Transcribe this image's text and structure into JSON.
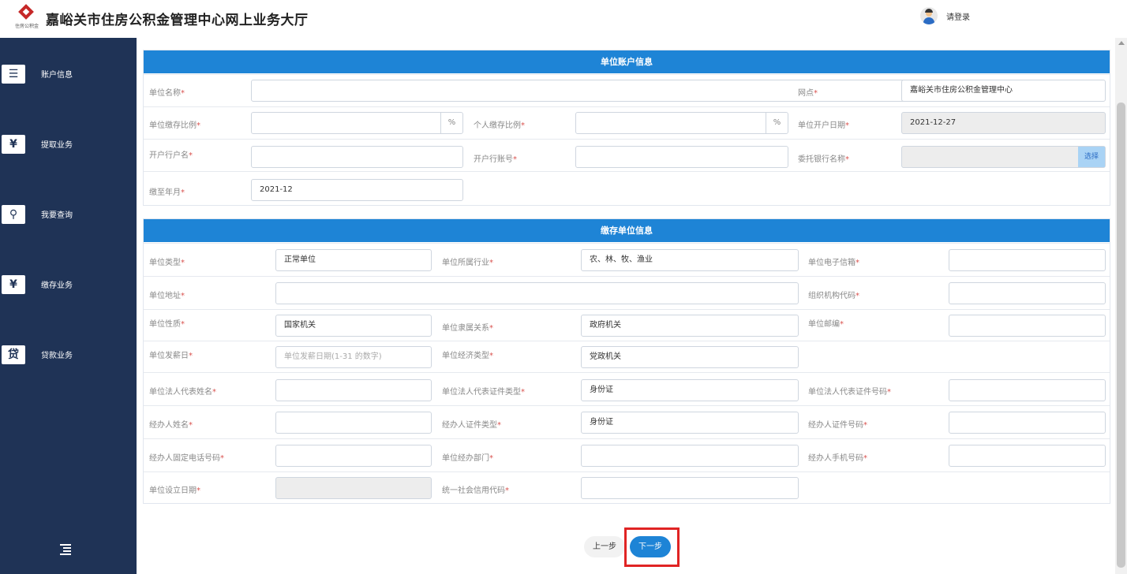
{
  "header": {
    "logo_text": "住房公积金",
    "title": "嘉峪关市住房公积金管理中心网上业务大厅",
    "login_label": "请登录"
  },
  "sidebar": {
    "items": [
      {
        "label": "账户信息",
        "icon": "account-card-icon",
        "glyph": "☰"
      },
      {
        "label": "提取业务",
        "icon": "yen-doc-icon",
        "glyph": "¥"
      },
      {
        "label": "我要查询",
        "icon": "search-icon",
        "glyph": "⚲"
      },
      {
        "label": "缴存业务",
        "icon": "yen-icon",
        "glyph": "¥"
      },
      {
        "label": "贷款业务",
        "icon": "loan-icon",
        "glyph": "贷"
      }
    ],
    "collapse_icon": "menu-collapse-icon"
  },
  "section1": {
    "title": "单位账户信息",
    "fields": {
      "unit_name": {
        "label": "单位名称",
        "value": ""
      },
      "branch": {
        "label": "网点",
        "value": "嘉峪关市住房公积金管理中心"
      },
      "unit_ratio": {
        "label": "单位缴存比例",
        "value": "",
        "unit": "%"
      },
      "personal_ratio": {
        "label": "个人缴存比例",
        "value": "",
        "unit": "%"
      },
      "open_date": {
        "label": "单位开户日期",
        "value": "2021-12-27"
      },
      "bank_account_name": {
        "label": "开户行户名",
        "value": ""
      },
      "bank_account_no": {
        "label": "开户行账号",
        "value": ""
      },
      "trust_bank": {
        "label": "委托银行名称",
        "value": "",
        "button": "选择"
      },
      "paid_until": {
        "label": "缴至年月",
        "value": "2021-12"
      }
    }
  },
  "section2": {
    "title": "缴存单位信息",
    "fields": {
      "unit_type": {
        "label": "单位类型",
        "value": "正常单位"
      },
      "industry": {
        "label": "单位所属行业",
        "value": "农、林、牧、渔业"
      },
      "email": {
        "label": "单位电子信箱",
        "value": ""
      },
      "address": {
        "label": "单位地址",
        "value": ""
      },
      "org_code": {
        "label": "组织机构代码",
        "value": ""
      },
      "nature": {
        "label": "单位性质",
        "value": "国家机关"
      },
      "affiliation": {
        "label": "单位隶属关系",
        "value": "政府机关"
      },
      "postcode": {
        "label": "单位邮编",
        "value": ""
      },
      "payday": {
        "label": "单位发薪日",
        "value": "",
        "placeholder": "单位发薪日期(1-31 的数字)"
      },
      "economy_type": {
        "label": "单位经济类型",
        "value": "党政机关"
      },
      "legal_name": {
        "label": "单位法人代表姓名",
        "value": ""
      },
      "legal_id_type": {
        "label": "单位法人代表证件类型",
        "value": "身份证"
      },
      "legal_id_no": {
        "label": "单位法人代表证件号码",
        "value": ""
      },
      "agent_name": {
        "label": "经办人姓名",
        "value": ""
      },
      "agent_id_type": {
        "label": "经办人证件类型",
        "value": "身份证"
      },
      "agent_id_no": {
        "label": "经办人证件号码",
        "value": ""
      },
      "agent_phone": {
        "label": "经办人固定电话号码",
        "value": ""
      },
      "agent_dept": {
        "label": "单位经办部门",
        "value": ""
      },
      "agent_mobile": {
        "label": "经办人手机号码",
        "value": ""
      },
      "setup_date": {
        "label": "单位设立日期",
        "value": ""
      },
      "credit_code": {
        "label": "统一社会信用代码",
        "value": ""
      }
    }
  },
  "footer": {
    "prev_label": "上一步",
    "next_label": "下一步"
  }
}
